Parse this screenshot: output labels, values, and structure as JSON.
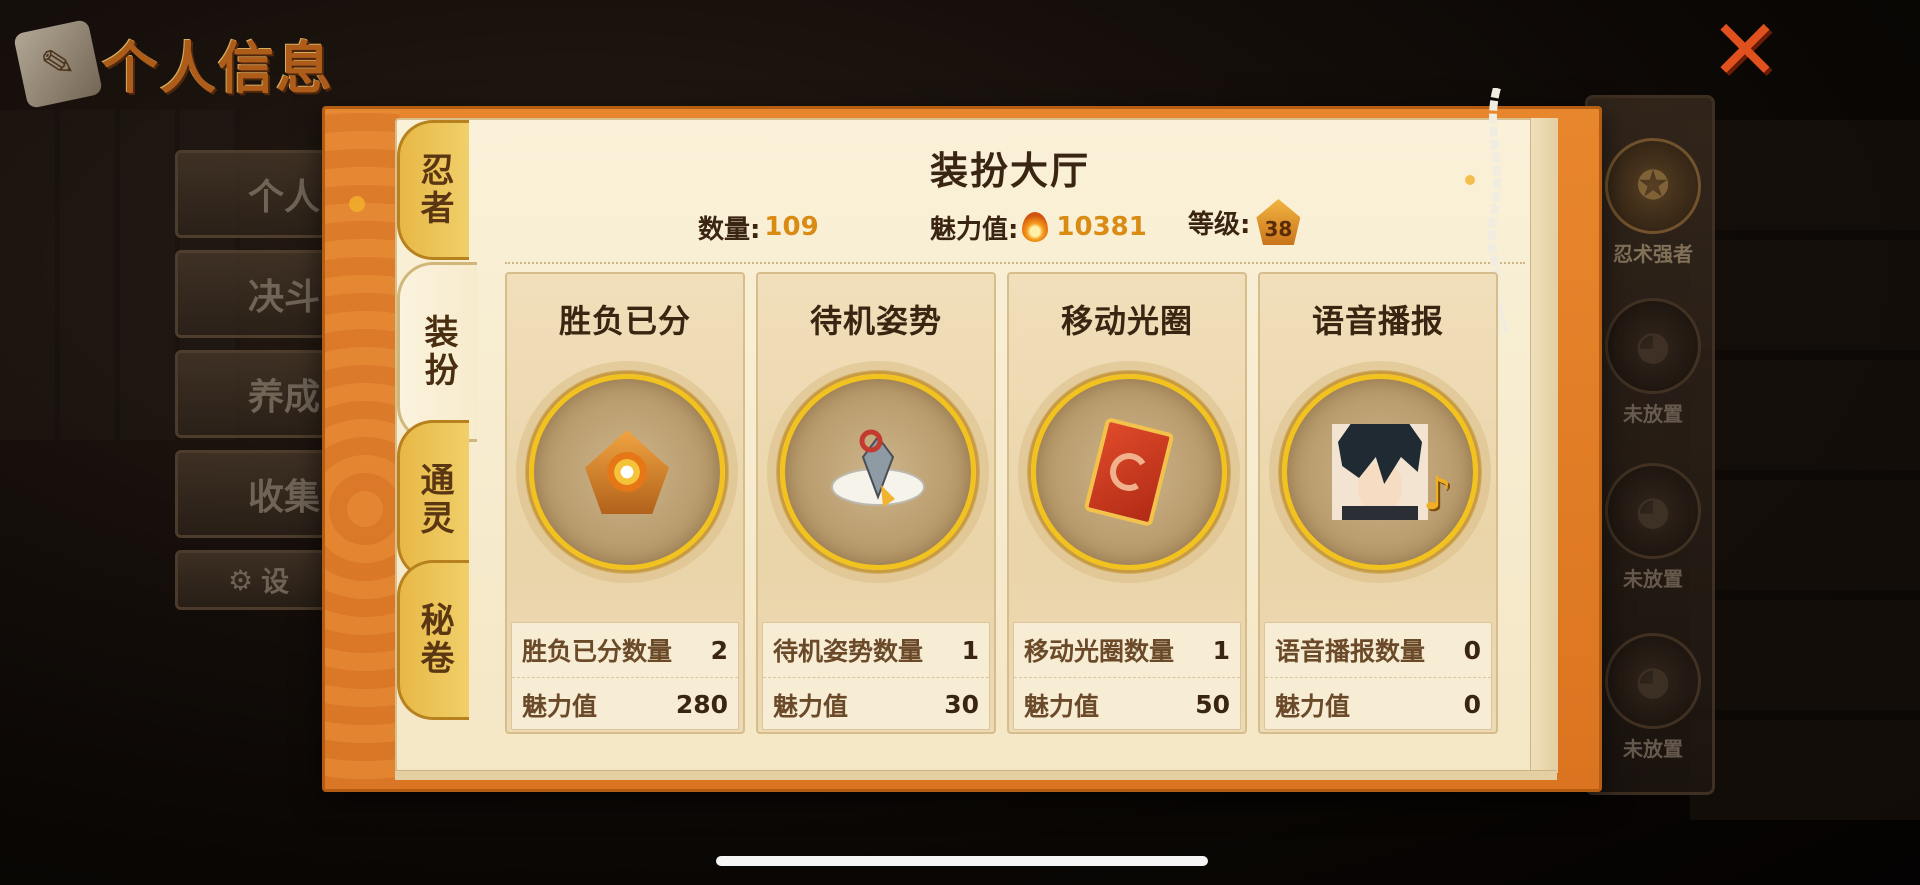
{
  "page": {
    "title": "个人信息"
  },
  "left_menu": {
    "items": [
      {
        "label": "个人"
      },
      {
        "label": "决斗"
      },
      {
        "label": "养成"
      },
      {
        "label": "收集"
      },
      {
        "label": "设"
      }
    ]
  },
  "tabs": [
    {
      "label": "忍者",
      "active": false
    },
    {
      "label": "装扮",
      "active": true
    },
    {
      "label": "通灵",
      "active": false
    },
    {
      "label": "秘卷",
      "active": false
    }
  ],
  "hall": {
    "title": "装扮大厅",
    "count_label": "数量:",
    "count_value": "109",
    "charm_label": "魅力值:",
    "charm_value": "10381",
    "level_label": "等级:",
    "level_value": "38"
  },
  "cards": [
    {
      "title": "胜负已分",
      "icon": "victory-badge-icon",
      "count_label": "胜负已分数量",
      "count": "2",
      "charm_label": "魅力值",
      "charm": "280"
    },
    {
      "title": "待机姿势",
      "icon": "kunai-scroll-icon",
      "count_label": "待机姿势数量",
      "count": "1",
      "charm_label": "魅力值",
      "charm": "30"
    },
    {
      "title": "移动光圈",
      "icon": "red-card-icon",
      "count_label": "移动光圈数量",
      "count": "1",
      "charm_label": "魅力值",
      "charm": "50"
    },
    {
      "title": "语音播报",
      "icon": "ninja-portrait-icon",
      "count_label": "语音播报数量",
      "count": "0",
      "charm_label": "魅力值",
      "charm": "0"
    }
  ],
  "right_rail": {
    "slots": [
      {
        "label": "忍术强者",
        "active": true
      },
      {
        "label": "未放置",
        "active": false
      },
      {
        "label": "未放置",
        "active": false
      },
      {
        "label": "未放置",
        "active": false
      }
    ]
  },
  "colors": {
    "frame_orange": "#e8862d",
    "parchment": "#faf1d8",
    "gold_ring": "#f2c21f",
    "value_orange": "#d98b13",
    "close_red": "#e0511e"
  }
}
